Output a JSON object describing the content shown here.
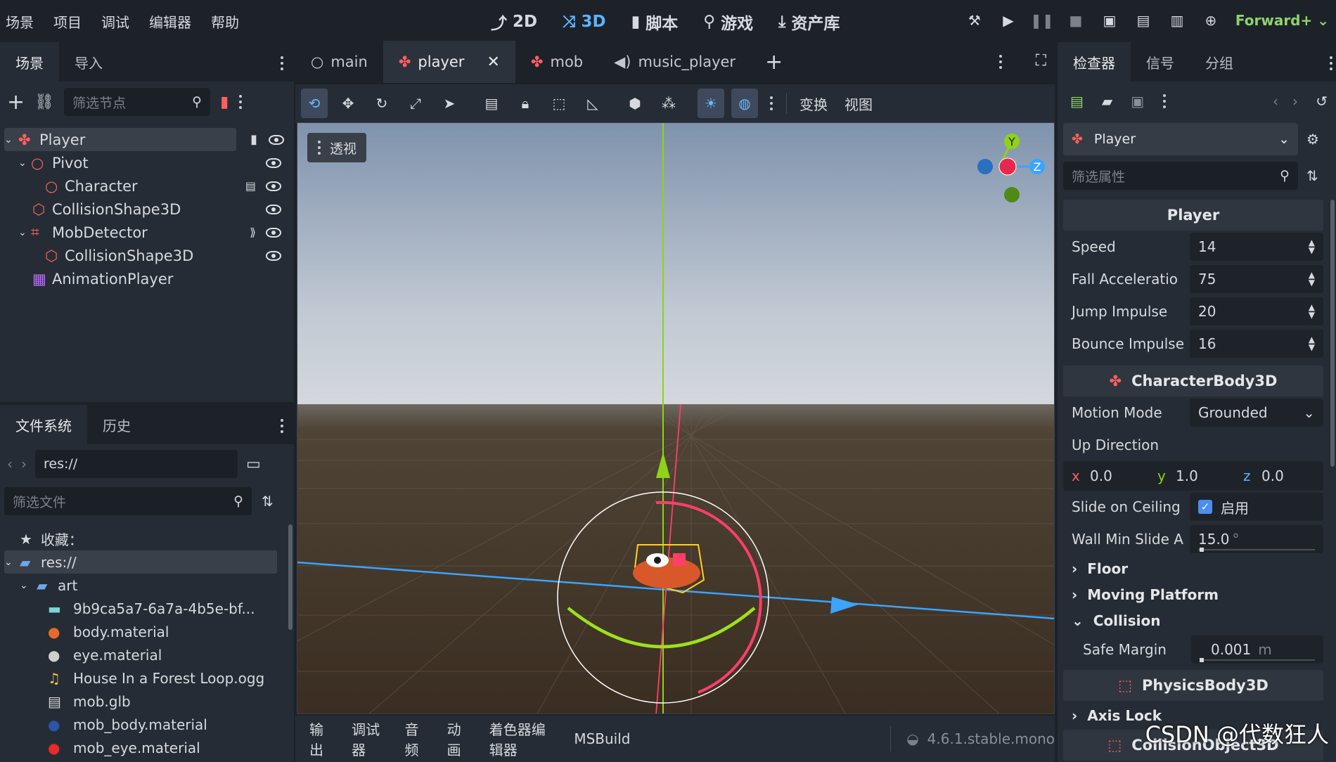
{
  "menu": [
    "场景",
    "项目",
    "调试",
    "编辑器",
    "帮助"
  ],
  "modes": [
    {
      "label": "2D",
      "icon": "2d-icon"
    },
    {
      "label": "3D",
      "icon": "3d-icon"
    },
    {
      "label": "脚本",
      "icon": "script-icon"
    },
    {
      "label": "游戏",
      "icon": "game-icon"
    },
    {
      "label": "资产库",
      "icon": "assetlib-icon"
    }
  ],
  "renderer": "Forward+",
  "scene_dock": {
    "tabs": [
      "场景",
      "导入"
    ],
    "filter_placeholder": "筛选节点",
    "nodes": [
      {
        "label": "Player",
        "depth": 0,
        "icon": "character-body-icon"
      },
      {
        "label": "Pivot",
        "depth": 1,
        "icon": "node3d-icon"
      },
      {
        "label": "Character",
        "depth": 2,
        "icon": "node3d-icon"
      },
      {
        "label": "CollisionShape3D",
        "depth": 1,
        "icon": "collision-shape-icon"
      },
      {
        "label": "MobDetector",
        "depth": 1,
        "icon": "area3d-icon"
      },
      {
        "label": "CollisionShape3D",
        "depth": 2,
        "icon": "collision-shape-icon"
      },
      {
        "label": "AnimationPlayer",
        "depth": 1,
        "icon": "animation-player-icon"
      }
    ]
  },
  "filesystem_dock": {
    "tabs": [
      "文件系统",
      "历史"
    ],
    "path": "res://",
    "filter_placeholder": "筛选文件",
    "favorites_label": "收藏：",
    "items": [
      {
        "label": "res://",
        "depth": 0,
        "icon": "folder-icon"
      },
      {
        "label": "art",
        "depth": 1,
        "icon": "folder-icon"
      },
      {
        "label": "9b9ca5a7-6a7a-4b5e-bf...",
        "depth": 2,
        "icon": "image-icon"
      },
      {
        "label": "body.material",
        "depth": 2,
        "icon": "material-icon"
      },
      {
        "label": "eye.material",
        "depth": 2,
        "icon": "material-icon"
      },
      {
        "label": "House In a Forest Loop.ogg",
        "depth": 2,
        "icon": "audio-icon"
      },
      {
        "label": "mob.glb",
        "depth": 2,
        "icon": "scene-icon"
      },
      {
        "label": "mob_body.material",
        "depth": 2,
        "icon": "material-icon"
      },
      {
        "label": "mob_eye.material",
        "depth": 2,
        "icon": "material-icon"
      }
    ]
  },
  "doc_tabs": [
    {
      "label": "main",
      "icon": "node-icon"
    },
    {
      "label": "player",
      "icon": "character-body-icon"
    },
    {
      "label": "mob",
      "icon": "character-body-icon"
    },
    {
      "label": "music_player",
      "icon": "audio-icon"
    }
  ],
  "viewport": {
    "toolbar_menus": [
      "变换",
      "视图"
    ],
    "view_label": "透视",
    "gizmo_axes": [
      "Y",
      "Z"
    ]
  },
  "bottom_panel": {
    "tabs": [
      "输出",
      "调试器",
      "音频",
      "动画",
      "着色器编辑器",
      "MSBuild"
    ],
    "version": "4.6.1.stable.mono"
  },
  "inspector": {
    "tabs": [
      "检查器",
      "信号",
      "分组"
    ],
    "object": "Player",
    "filter_placeholder": "筛选属性",
    "sections": {
      "script": "Player",
      "body": "CharacterBody3D",
      "physics": "PhysicsBody3D",
      "collision_object": "CollisionObject3D"
    },
    "props": [
      {
        "label": "Speed",
        "value": "14"
      },
      {
        "label": "Fall Acceleratio",
        "value": "75"
      },
      {
        "label": "Jump Impulse",
        "value": "20"
      },
      {
        "label": "Bounce Impulse",
        "value": "16"
      }
    ],
    "motion_mode": {
      "label": "Motion Mode",
      "value": "Grounded"
    },
    "up_direction": {
      "label": "Up Direction",
      "x": "0.0",
      "y": "1.0",
      "z": "0.0"
    },
    "slide_on_ceiling": {
      "label": "Slide on Ceiling",
      "value": "启用",
      "checked": true
    },
    "wall_min_slide": {
      "label": "Wall Min Slide A",
      "value": "15.0",
      "unit": "°"
    },
    "folds": [
      "Floor",
      "Moving Platform",
      "Collision"
    ],
    "safe_margin": {
      "label": "Safe Margin",
      "value": "0.001",
      "unit": "m"
    },
    "axis_lock": "Axis Lock"
  },
  "watermark": "CSDN @代数狂人",
  "colors": {
    "accent": "#5fb2ff",
    "renderer": "#8fd36a",
    "node_red": "#ff5f5f"
  }
}
